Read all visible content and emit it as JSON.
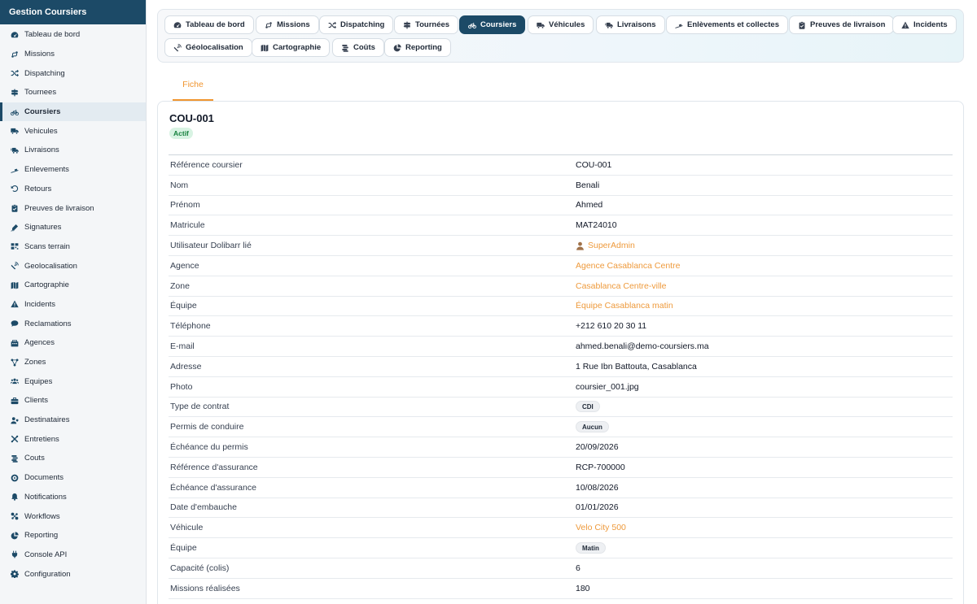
{
  "app": {
    "title": "Gestion Coursiers"
  },
  "sidebar": {
    "items": [
      {
        "label": "Tableau de bord",
        "icon": "dashboard-icon"
      },
      {
        "label": "Missions",
        "icon": "route-icon"
      },
      {
        "label": "Dispatching",
        "icon": "shuffle-icon"
      },
      {
        "label": "Tournees",
        "icon": "signpost-icon"
      },
      {
        "label": "Coursiers",
        "icon": "bicycle-icon",
        "active": true
      },
      {
        "label": "Vehicules",
        "icon": "truck-icon"
      },
      {
        "label": "Livraisons",
        "icon": "truck-fast-icon"
      },
      {
        "label": "Enlevements",
        "icon": "ramp-icon"
      },
      {
        "label": "Retours",
        "icon": "undo-icon"
      },
      {
        "label": "Preuves de livraison",
        "icon": "clipboard-check-icon"
      },
      {
        "label": "Signatures",
        "icon": "signature-icon"
      },
      {
        "label": "Scans terrain",
        "icon": "barcode-icon"
      },
      {
        "label": "Geolocalisation",
        "icon": "satellite-icon"
      },
      {
        "label": "Cartographie",
        "icon": "map-icon"
      },
      {
        "label": "Incidents",
        "icon": "warning-icon"
      },
      {
        "label": "Reclamations",
        "icon": "comment-icon"
      },
      {
        "label": "Agences",
        "icon": "building-icon"
      },
      {
        "label": "Zones",
        "icon": "zones-icon"
      },
      {
        "label": "Equipes",
        "icon": "users-icon"
      },
      {
        "label": "Clients",
        "icon": "briefcase-icon"
      },
      {
        "label": "Destinataires",
        "icon": "user-tag-icon"
      },
      {
        "label": "Entretiens",
        "icon": "tools-icon"
      },
      {
        "label": "Couts",
        "icon": "coins-icon"
      },
      {
        "label": "Documents",
        "icon": "documents-icon"
      },
      {
        "label": "Notifications",
        "icon": "bell-icon"
      },
      {
        "label": "Workflows",
        "icon": "workflow-icon"
      },
      {
        "label": "Reporting",
        "icon": "pie-chart-icon"
      },
      {
        "label": "Console API",
        "icon": "plug-icon"
      },
      {
        "label": "Configuration",
        "icon": "gear-icon"
      }
    ]
  },
  "topnav": {
    "tabs": [
      {
        "label": "Tableau de bord",
        "icon": "dashboard-icon"
      },
      {
        "label": "Missions",
        "icon": "route-icon"
      },
      {
        "label": "Dispatching",
        "icon": "shuffle-icon"
      },
      {
        "label": "Tournées",
        "icon": "signpost-icon"
      },
      {
        "label": "Coursiers",
        "icon": "bicycle-icon",
        "active": true
      },
      {
        "label": "Véhicules",
        "icon": "truck-icon"
      },
      {
        "label": "Livraisons",
        "icon": "truck-fast-icon"
      },
      {
        "label": "Enlèvements et collectes",
        "icon": "ramp-icon"
      },
      {
        "label": "Preuves de livraison",
        "icon": "clipboard-check-icon"
      },
      {
        "label": "Incidents",
        "icon": "warning-icon"
      },
      {
        "label": "Géolocalisation",
        "icon": "satellite-icon"
      },
      {
        "label": "Cartographie",
        "icon": "map-icon"
      },
      {
        "label": "Coûts",
        "icon": "coins-icon"
      },
      {
        "label": "Reporting",
        "icon": "pie-chart-icon"
      }
    ]
  },
  "subtabs": {
    "fiche": "Fiche"
  },
  "record": {
    "ref": "COU-001",
    "status": "Actif",
    "fields": [
      {
        "label": "Référence coursier",
        "value": "COU-001",
        "type": "text"
      },
      {
        "label": "Nom",
        "value": "Benali",
        "type": "text"
      },
      {
        "label": "Prénom",
        "value": "Ahmed",
        "type": "text"
      },
      {
        "label": "Matricule",
        "value": "MAT24010",
        "type": "text"
      },
      {
        "label": "Utilisateur Dolibarr lié",
        "value": "SuperAdmin",
        "type": "user-link"
      },
      {
        "label": "Agence",
        "value": "Agence Casablanca Centre",
        "type": "link"
      },
      {
        "label": "Zone",
        "value": "Casablanca Centre-ville",
        "type": "link"
      },
      {
        "label": "Équipe",
        "value": "Équipe Casablanca matin",
        "type": "link"
      },
      {
        "label": "Téléphone",
        "value": "+212 610 20 30 11",
        "type": "text"
      },
      {
        "label": "E-mail",
        "value": "ahmed.benali@demo-coursiers.ma",
        "type": "text"
      },
      {
        "label": "Adresse",
        "value": "1 Rue Ibn Battouta, Casablanca",
        "type": "text"
      },
      {
        "label": "Photo",
        "value": "coursier_001.jpg",
        "type": "text"
      },
      {
        "label": "Type de contrat",
        "value": "CDI",
        "type": "pill"
      },
      {
        "label": "Permis de conduire",
        "value": "Aucun",
        "type": "pill"
      },
      {
        "label": "Échéance du permis",
        "value": "20/09/2026",
        "type": "text"
      },
      {
        "label": "Référence d'assurance",
        "value": "RCP-700000",
        "type": "text"
      },
      {
        "label": "Échéance d'assurance",
        "value": "10/08/2026",
        "type": "text"
      },
      {
        "label": "Date d'embauche",
        "value": "01/01/2026",
        "type": "text"
      },
      {
        "label": "Véhicule",
        "value": "Velo City 500",
        "type": "link"
      },
      {
        "label": "Équipe",
        "value": "Matin",
        "type": "pill"
      },
      {
        "label": "Capacité (colis)",
        "value": "6",
        "type": "text"
      },
      {
        "label": "Missions réalisées",
        "value": "180",
        "type": "text"
      }
    ]
  },
  "colors": {
    "brand": "#1c4a67",
    "accent": "#f0952f",
    "success": "#15803d"
  }
}
